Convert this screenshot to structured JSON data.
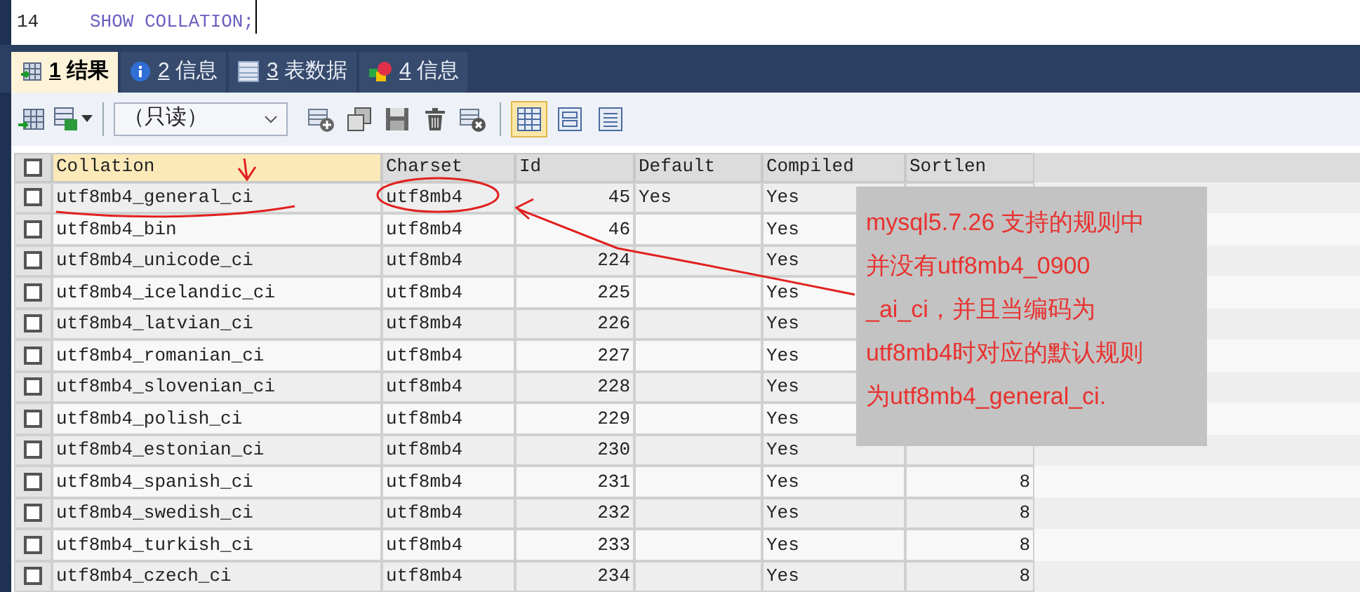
{
  "editor": {
    "line_number": "14",
    "code": "SHOW COLLATION;"
  },
  "tabs": [
    {
      "key": "1",
      "label": "结果",
      "selected": true
    },
    {
      "key": "2",
      "label": "信息",
      "selected": false
    },
    {
      "key": "3",
      "label": "表数据",
      "selected": false
    },
    {
      "key": "4",
      "label": "信息",
      "selected": false
    }
  ],
  "toolbar": {
    "mode_select": "（只读）",
    "views": [
      {
        "selected": true
      },
      {
        "selected": false
      },
      {
        "selected": false
      }
    ]
  },
  "table": {
    "all_checked": false,
    "columns": [
      "Collation",
      "Charset",
      "Id",
      "Default",
      "Compiled",
      "Sortlen"
    ],
    "rows": [
      {
        "checked": false,
        "cells": [
          "utf8mb4_general_ci",
          "utf8mb4",
          "45",
          "Yes",
          "Yes"
        ]
      },
      {
        "checked": false,
        "cells": [
          "utf8mb4_bin",
          "utf8mb4",
          "46",
          "",
          "Yes"
        ]
      },
      {
        "checked": false,
        "cells": [
          "utf8mb4_unicode_ci",
          "utf8mb4",
          "224",
          "",
          "Yes"
        ]
      },
      {
        "checked": false,
        "cells": [
          "utf8mb4_icelandic_ci",
          "utf8mb4",
          "225",
          "",
          "Yes"
        ]
      },
      {
        "checked": false,
        "cells": [
          "utf8mb4_latvian_ci",
          "utf8mb4",
          "226",
          "",
          "Yes"
        ]
      },
      {
        "checked": false,
        "cells": [
          "utf8mb4_romanian_ci",
          "utf8mb4",
          "227",
          "",
          "Yes"
        ]
      },
      {
        "checked": false,
        "cells": [
          "utf8mb4_slovenian_ci",
          "utf8mb4",
          "228",
          "",
          "Yes"
        ]
      },
      {
        "checked": false,
        "cells": [
          "utf8mb4_polish_ci",
          "utf8mb4",
          "229",
          "",
          "Yes"
        ]
      },
      {
        "checked": false,
        "cells": [
          "utf8mb4_estonian_ci",
          "utf8mb4",
          "230",
          "",
          "Yes"
        ]
      },
      {
        "checked": false,
        "cells": [
          "utf8mb4_spanish_ci",
          "utf8mb4",
          "231",
          "",
          "Yes",
          "8"
        ]
      },
      {
        "checked": false,
        "cells": [
          "utf8mb4_swedish_ci",
          "utf8mb4",
          "232",
          "",
          "Yes",
          "8"
        ]
      },
      {
        "checked": false,
        "cells": [
          "utf8mb4_turkish_ci",
          "utf8mb4",
          "233",
          "",
          "Yes",
          "8"
        ]
      },
      {
        "checked": false,
        "cells": [
          "utf8mb4_czech_ci",
          "utf8mb4",
          "234",
          "",
          "Yes",
          "8"
        ]
      }
    ]
  },
  "annotation": {
    "lines": [
      "mysql5.7.26 支持的规则中",
      "并没有utf8mb4_0900",
      "_ai_ci，并且当编码为",
      "utf8mb4时对应的默认规则",
      "为utf8mb4_general_ci."
    ]
  }
}
